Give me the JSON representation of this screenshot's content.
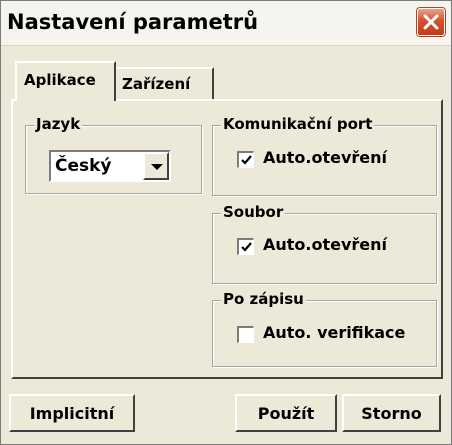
{
  "window": {
    "title": "Nastavení parametrů",
    "close_icon": "close-icon",
    "close_color": "#d5522e"
  },
  "tabs": [
    {
      "label": "Aplikace",
      "active": true
    },
    {
      "label": "Zařízení",
      "active": false
    }
  ],
  "language": {
    "group_label": "Jazyk",
    "selected": "Český"
  },
  "com_port": {
    "group_label": "Komunikační port",
    "checkbox_label": "Auto.otevření",
    "checked": true
  },
  "file": {
    "group_label": "Soubor",
    "checkbox_label": "Auto.otevření",
    "checked": true
  },
  "after_write": {
    "group_label": "Po zápisu",
    "checkbox_label": "Auto. verifikace",
    "checked": false
  },
  "buttons": {
    "default_label": "Implicitní",
    "apply_label": "Použít",
    "cancel_label": "Storno"
  }
}
